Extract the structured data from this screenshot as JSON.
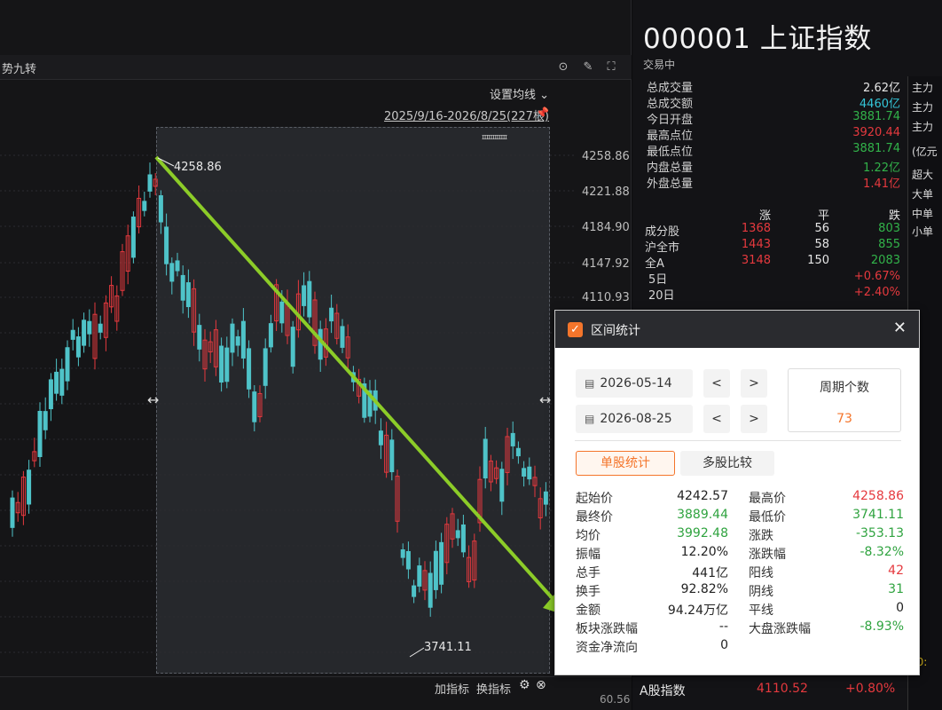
{
  "chart": {
    "title": "势九转",
    "ma_setting": "设置均线 ⌄",
    "range_label": "2025/9/16-2026/8/25(227根)",
    "price_ticks": [
      "4258.86",
      "4221.88",
      "4184.90",
      "4147.92",
      "4110.93"
    ],
    "high_label": "4258.86",
    "low_label": "3741.11",
    "add_indicator": "加指标",
    "change_indicator": "换指标",
    "bottom_value": "60.56"
  },
  "quote": {
    "code_name": "000001 上证指数",
    "status": "交易中",
    "rows": [
      {
        "label": "总成交量",
        "value": "2.62亿",
        "color": "white"
      },
      {
        "label": "总成交额",
        "value": "4460亿",
        "color": "cyan"
      },
      {
        "label": "今日开盘",
        "value": "3881.74",
        "color": "green"
      },
      {
        "label": "最高点位",
        "value": "3920.44",
        "color": "red"
      },
      {
        "label": "最低点位",
        "value": "3881.74",
        "color": "green"
      },
      {
        "label": "内盘总量",
        "value": "1.22亿",
        "color": "green"
      },
      {
        "label": "外盘总量",
        "value": "1.41亿",
        "color": "red"
      }
    ],
    "breadth_header": [
      "",
      "涨",
      "平",
      "跌"
    ],
    "breadth_rows": [
      {
        "name": "成分股",
        "up": "1368",
        "flat": "56",
        "down": "803"
      },
      {
        "name": "沪全市",
        "up": "1443",
        "flat": "58",
        "down": "855"
      },
      {
        "name": "全A",
        "up": "3148",
        "flat": "150",
        "down": "2083"
      }
    ],
    "period_rows": [
      {
        "name": "5日",
        "value": "+0.67%"
      },
      {
        "name": "20日",
        "value": "+2.40%"
      }
    ],
    "edge_labels": [
      "主力",
      "主力",
      "主力",
      "(亿元",
      "超大",
      "大单",
      "中单",
      "小单"
    ],
    "bottom": {
      "name": "A股指数",
      "price": "4110.52",
      "change": "+0.80%"
    }
  },
  "dialog": {
    "title": "区间统计",
    "start_date": "2026-05-14",
    "end_date": "2026-08-25",
    "prev": "<",
    "next": ">",
    "period_label": "周期个数",
    "period_value": "73",
    "tab_single": "单股统计",
    "tab_multi": "多股比较",
    "stats": [
      {
        "l1": "起始价",
        "v1": "4242.57",
        "c1": "dk",
        "l2": "最高价",
        "v2": "4258.86",
        "c2": "rd"
      },
      {
        "l1": "最终价",
        "v1": "3889.44",
        "c1": "gr",
        "l2": "最低价",
        "v2": "3741.11",
        "c2": "gr"
      },
      {
        "l1": "均价",
        "v1": "3992.48",
        "c1": "gr",
        "l2": "涨跌",
        "v2": "-353.13",
        "c2": "gr"
      },
      {
        "l1": "振幅",
        "v1": "12.20%",
        "c1": "dk",
        "l2": "涨跌幅",
        "v2": "-8.32%",
        "c2": "gr"
      },
      {
        "l1": "总手",
        "v1": "441亿",
        "c1": "dk",
        "l2": "阳线",
        "v2": "42",
        "c2": "rd"
      },
      {
        "l1": "换手",
        "v1": "92.82%",
        "c1": "dk",
        "l2": "阴线",
        "v2": "31",
        "c2": "gr"
      },
      {
        "l1": "金额",
        "v1": "94.24万亿",
        "c1": "dk",
        "l2": "平线",
        "v2": "0",
        "c2": "dk"
      },
      {
        "l1": "板块涨跌幅",
        "v1": "--",
        "c1": "dk",
        "l2": "大盘涨跌幅",
        "v2": "-8.93%",
        "c2": "gr"
      },
      {
        "l1": "资金净流向",
        "v1": "0",
        "c1": "dk",
        "l2": "",
        "v2": "",
        "c2": "dk"
      }
    ]
  },
  "colors": {
    "up": "#e5393e",
    "down": "#4fc3c9",
    "accent": "#f4752b",
    "arrow": "#8ccc28"
  }
}
